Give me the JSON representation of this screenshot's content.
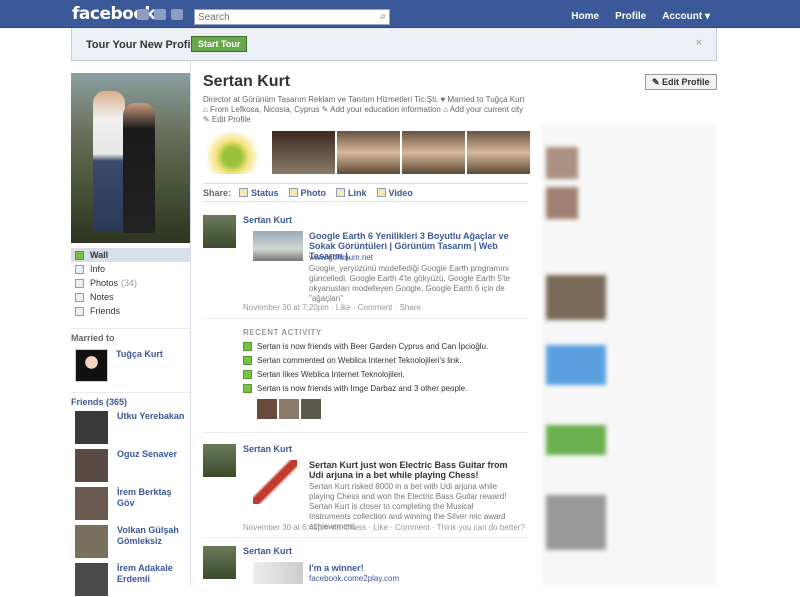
{
  "topbar": {
    "logo": "facebook",
    "search_placeholder": "Search",
    "nav": [
      "Home",
      "Profile",
      "Account ▾"
    ]
  },
  "tour": {
    "title": "Tour Your New Profile",
    "button": "Start Tour",
    "close": "×"
  },
  "profile": {
    "name": "Sertan Kurt",
    "edit_button": "Edit Profile",
    "info_line": "Director at Görünüm Tasarım Reklam ve Tanıtım Hizmetleri Tic.Şti. ♥ Married to Tuğça Kurt ⌂ From Lefkosa, Nicosia, Cyprus ✎ Add your education information ⌂ Add your current city ✎ Edit Profile"
  },
  "left_nav": [
    {
      "label": "Wall",
      "count": ""
    },
    {
      "label": "Info",
      "count": ""
    },
    {
      "label": "Photos",
      "count": "(34)"
    },
    {
      "label": "Notes",
      "count": ""
    },
    {
      "label": "Friends",
      "count": ""
    }
  ],
  "married": {
    "heading": "Married to",
    "name": "Tuğça Kurt"
  },
  "friends": {
    "heading": "Friends (365)",
    "list": [
      "Utku Yerebakan",
      "Oguz Senaver",
      "İrem Berktaş Göv",
      "Volkan Gülşah Gömleksiz",
      "İrem Adakale Erdemli"
    ]
  },
  "share": {
    "label": "Share:",
    "items": [
      "Status",
      "Photo",
      "Link",
      "Video"
    ]
  },
  "stories": [
    {
      "name": "Sertan Kurt",
      "title": "Google Earth 6 Yenilikleri 3 Boyutlu Ağaçlar ve Sokak Görüntüleri | Görünüm Tasarım | Web Tasarım |.",
      "url": "www.gorunum.net",
      "desc": "Google, yeryüzünü modellediği Google Earth programını güncelledi. Google Earth 4'te gökyüzü, Google Earth 5'te okyanusları modelleyen Google, Google Earth 6 için de \"ağaçları\"",
      "meta": "November 30 at 7:20pm · Like · Comment · Share"
    },
    {
      "name": "Sertan Kurt",
      "title": "Sertan Kurt just won Electric Bass Guitar from Udi arjuna in a bet while playing Chess!",
      "desc": "Sertan Kurt risked 8000 in a bet with Udi arjuna while playing Chess and won the Electric Bass Guitar reward! Sertan Kurt is closer to completing the Musical Instruments collection and winning the Silver mic award achievement.",
      "meta": "November 30 at 6:42pm via Chess · Like · Comment · Think you can do better?"
    },
    {
      "name": "Sertan Kurt",
      "title": "I'm a winner!",
      "url": "facebook.come2play.com"
    }
  ],
  "recent_activity": {
    "heading": "RECENT ACTIVITY",
    "rows": [
      "Sertan is now friends with Beer Garden Cyprus and Can İpcioğlu.",
      "Sertan commented on Weblica Internet Teknolojileri's link.",
      "Sertan likes Weblica Internet Teknolojileri.",
      "Sertan is now friends with Imge Darbaz and 3 other people."
    ]
  }
}
